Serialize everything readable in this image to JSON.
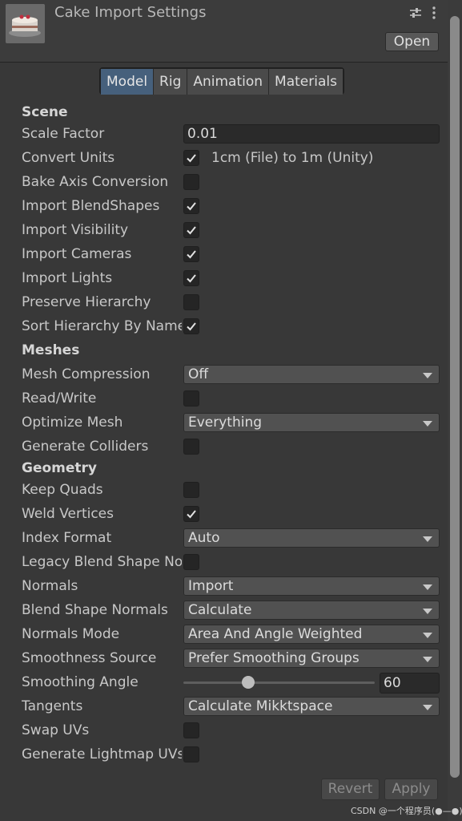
{
  "header": {
    "title": "Cake Import Settings",
    "open_label": "Open",
    "icons": [
      "cake-thumbnail",
      "sliders-icon",
      "kebab-menu-icon"
    ]
  },
  "tabs": [
    {
      "label": "Model",
      "active": true
    },
    {
      "label": "Rig",
      "active": false
    },
    {
      "label": "Animation",
      "active": false
    },
    {
      "label": "Materials",
      "active": false
    }
  ],
  "scene": {
    "heading": "Scene",
    "scale_factor_label": "Scale Factor",
    "scale_factor_value": "0.01",
    "convert_units_label": "Convert Units",
    "convert_units_checked": true,
    "convert_units_note": "1cm (File) to 1m (Unity)",
    "bake_axis_label": "Bake Axis Conversion",
    "bake_axis_checked": false,
    "import_blendshapes_label": "Import BlendShapes",
    "import_blendshapes_checked": true,
    "import_visibility_label": "Import Visibility",
    "import_visibility_checked": true,
    "import_cameras_label": "Import Cameras",
    "import_cameras_checked": true,
    "import_lights_label": "Import Lights",
    "import_lights_checked": true,
    "preserve_hierarchy_label": "Preserve Hierarchy",
    "preserve_hierarchy_checked": false,
    "sort_hierarchy_label": "Sort Hierarchy By Name",
    "sort_hierarchy_checked": true
  },
  "meshes": {
    "heading": "Meshes",
    "mesh_compression_label": "Mesh Compression",
    "mesh_compression_value": "Off",
    "read_write_label": "Read/Write",
    "read_write_checked": false,
    "optimize_mesh_label": "Optimize Mesh",
    "optimize_mesh_value": "Everything",
    "generate_colliders_label": "Generate Colliders",
    "generate_colliders_checked": false
  },
  "geometry": {
    "heading": "Geometry",
    "keep_quads_label": "Keep Quads",
    "keep_quads_checked": false,
    "weld_vertices_label": "Weld Vertices",
    "weld_vertices_checked": true,
    "index_format_label": "Index Format",
    "index_format_value": "Auto",
    "legacy_blend_label": "Legacy Blend Shape Normals",
    "legacy_blend_checked": false,
    "normals_label": "Normals",
    "normals_value": "Import",
    "blend_shape_normals_label": "Blend Shape Normals",
    "blend_shape_normals_value": "Calculate",
    "normals_mode_label": "Normals Mode",
    "normals_mode_value": "Area And Angle Weighted",
    "smoothness_source_label": "Smoothness Source",
    "smoothness_source_value": "Prefer Smoothing Groups",
    "smoothing_angle_label": "Smoothing Angle",
    "smoothing_angle_value": "60",
    "smoothing_angle_fraction": 0.33,
    "tangents_label": "Tangents",
    "tangents_value": "Calculate Mikktspace",
    "swap_uvs_label": "Swap UVs",
    "swap_uvs_checked": false,
    "generate_lightmap_label": "Generate Lightmap UVs",
    "generate_lightmap_checked": false
  },
  "footer": {
    "revert_label": "Revert",
    "apply_label": "Apply"
  },
  "watermark": "CSDN @一个程序员(●—●)",
  "colors": {
    "background": "#383838",
    "active_tab": "#46607c",
    "field_bg": "#2a2a2a",
    "dropdown_bg": "#515151"
  }
}
